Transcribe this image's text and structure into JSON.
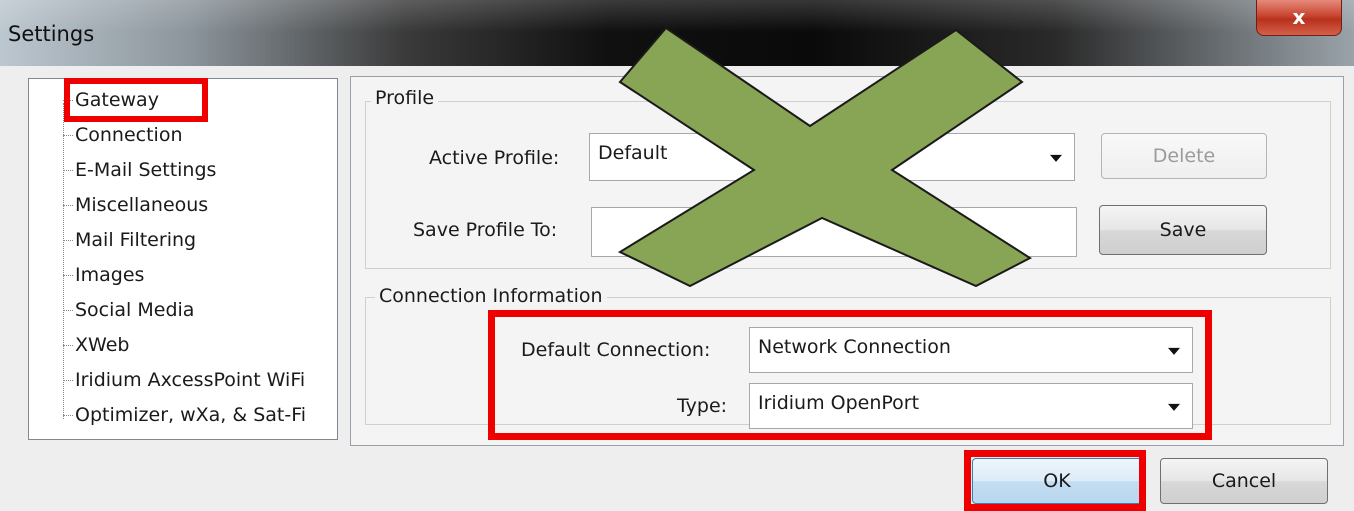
{
  "window": {
    "title": "Settings",
    "close_label": "x"
  },
  "sidebar": {
    "items": [
      {
        "label": "Gateway"
      },
      {
        "label": "Connection"
      },
      {
        "label": "E-Mail Settings"
      },
      {
        "label": "Miscellaneous"
      },
      {
        "label": "Mail Filtering"
      },
      {
        "label": "Images"
      },
      {
        "label": "Social Media"
      },
      {
        "label": "XWeb"
      },
      {
        "label": "Iridium AxcessPoint WiFi"
      },
      {
        "label": "Optimizer, wXa, & Sat-Fi"
      }
    ]
  },
  "profile": {
    "group_title": "Profile",
    "active_profile_label": "Active Profile:",
    "active_profile_value": "Default",
    "delete_label": "Delete",
    "save_profile_to_label": "Save Profile To:",
    "save_profile_to_value": "",
    "save_label": "Save"
  },
  "connection_info": {
    "group_title": "Connection Information",
    "default_connection_label": "Default Connection:",
    "default_connection_value": "Network Connection",
    "type_label": "Type:",
    "type_value": "Iridium OpenPort"
  },
  "footer": {
    "ok_label": "OK",
    "cancel_label": "Cancel"
  },
  "annotations": {
    "highlight_color": "#ee0000",
    "cross_color": "#88a455"
  }
}
